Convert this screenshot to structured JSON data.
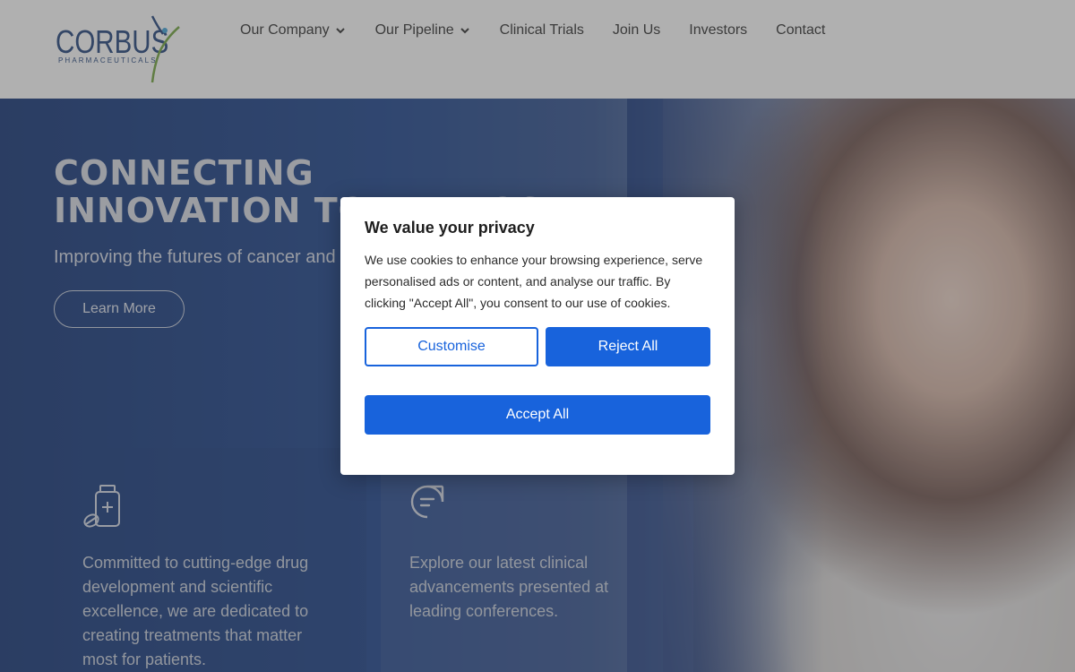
{
  "header": {
    "logo_main": "CORBUS",
    "logo_sub": "PHARMACEUTICALS",
    "nav": [
      {
        "label": "Our Company",
        "has_dropdown": true
      },
      {
        "label": "Our Pipeline",
        "has_dropdown": true
      },
      {
        "label": "Clinical Trials",
        "has_dropdown": false
      },
      {
        "label": "Join Us",
        "has_dropdown": false
      },
      {
        "label": "Investors",
        "has_dropdown": false
      },
      {
        "label": "Contact",
        "has_dropdown": false
      }
    ]
  },
  "hero": {
    "title_line1": "CONNECTING",
    "title_line2": "INNOVATION TO PURPOSE",
    "subtitle": "Improving the futures of cancer and o",
    "cta": "Learn More"
  },
  "cards": [
    {
      "icon": "medicine-bottle-icon",
      "text": "Committed to cutting-edge drug development and scientific excellence, we are dedicated to creating treatments that matter most for patients."
    },
    {
      "icon": "chat-bubble-icon",
      "text": "Explore our latest clinical advancements presented at leading conferences."
    }
  ],
  "cookie_dialog": {
    "title": "We value your privacy",
    "body": "We use cookies to enhance your browsing experience, serve personalised ads or content, and analyse our traffic. By clicking \"Accept All\", you consent to our use of cookies.",
    "customise": "Customise",
    "reject": "Reject All",
    "accept": "Accept All"
  },
  "colors": {
    "brand_navy": "#1c3e78",
    "consent_blue": "#1863dc",
    "hero_blue": "#0d2f73"
  }
}
